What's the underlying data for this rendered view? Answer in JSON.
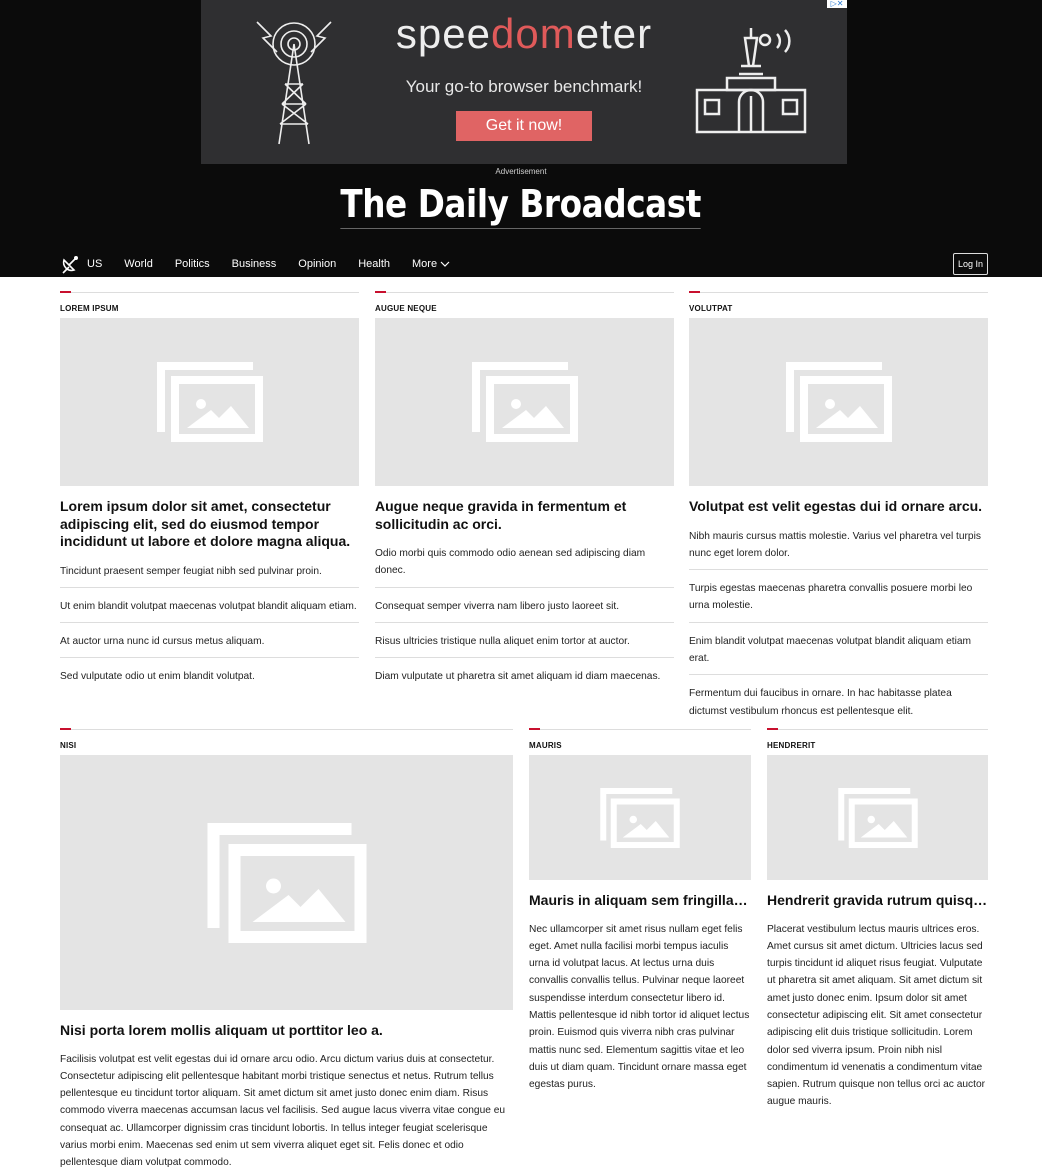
{
  "ad": {
    "brand_part1": "spee",
    "brand_part2": "dom",
    "brand_part3": "eter",
    "tagline": "Your go-to browser benchmark!",
    "cta": "Get it now!",
    "label": "Advertisement",
    "accent": "#e05a5a"
  },
  "masthead": {
    "title": "The Daily Broadcast"
  },
  "nav": {
    "items": [
      "US",
      "World",
      "Politics",
      "Business",
      "Opinion",
      "Health"
    ],
    "more": "More",
    "login": "Log In"
  },
  "top_row": [
    {
      "kicker": "LOREM IPSUM",
      "headline": "Lorem ipsum dolor sit amet, consectetur adipiscing elit, sed do eiusmod tempor incididunt ut labore et dolore magna aliqua.",
      "links": [
        "Tincidunt praesent semper feugiat nibh sed pulvinar proin.",
        "Ut enim blandit volutpat maecenas volutpat blandit aliquam etiam.",
        "At auctor urna nunc id cursus metus aliquam.",
        "Sed vulputate odio ut enim blandit volutpat."
      ]
    },
    {
      "kicker": "AUGUE NEQUE",
      "headline": "Augue neque gravida in fermentum et sollicitudin ac orci.",
      "links": [
        "Odio morbi quis commodo odio aenean sed adipiscing diam donec.",
        "Consequat semper viverra nam libero justo laoreet sit.",
        "Risus ultricies tristique nulla aliquet enim tortor at auctor.",
        "Diam vulputate ut pharetra sit amet aliquam id diam maecenas."
      ]
    },
    {
      "kicker": "VOLUTPAT",
      "headline": "Volutpat est velit egestas dui id ornare arcu.",
      "links": [
        "Nibh mauris cursus mattis molestie. Varius vel pharetra vel turpis nunc eget lorem dolor.",
        "Turpis egestas maecenas pharetra convallis posuere morbi leo urna molestie.",
        "Enim blandit volutpat maecenas volutpat blandit aliquam etiam erat.",
        "Fermentum dui faucibus in ornare. In hac habitasse platea dictumst vestibulum rhoncus est pellentesque elit."
      ]
    }
  ],
  "bottom_row": {
    "main": {
      "kicker": "NISI",
      "headline": "Nisi porta lorem mollis aliquam ut porttitor leo a.",
      "body": "Facilisis volutpat est velit egestas dui id ornare arcu odio. Arcu dictum varius duis at consectetur. Consectetur adipiscing elit pellentesque habitant morbi tristique senectus et netus. Rutrum tellus pellentesque eu tincidunt tortor aliquam. Sit amet dictum sit amet justo donec enim diam. Risus commodo viverra maecenas accumsan lacus vel facilisis. Sed augue lacus viverra vitae congue eu consequat ac. Ullamcorper dignissim cras tincidunt lobortis. In tellus integer feugiat scelerisque varius morbi enim. Maecenas sed enim ut sem viverra aliquet eget sit. Felis donec et odio pellentesque diam volutpat commodo."
    },
    "side1": {
      "kicker": "MAURIS",
      "headline": "Mauris in aliquam sem fringilla ut morbi tincidunt augue interdum.",
      "body": "Nec ullamcorper sit amet risus nullam eget felis eget. Amet nulla facilisi morbi tempus iaculis urna id volutpat lacus. At lectus urna duis convallis convallis tellus. Pulvinar neque laoreet suspendisse interdum consectetur libero id. Mattis pellentesque id nibh tortor id aliquet lectus proin. Euismod quis viverra nibh cras pulvinar mattis nunc sed. Elementum sagittis vitae et leo duis ut diam quam. Tincidunt ornare massa eget egestas purus."
    },
    "side2": {
      "kicker": "HENDRERIT",
      "headline": "Hendrerit gravida rutrum quisque non tellus orci ac auctor.",
      "body": "Placerat vestibulum lectus mauris ultrices eros. Amet cursus sit amet dictum. Ultricies lacus sed turpis tincidunt id aliquet risus feugiat. Vulputate ut pharetra sit amet aliquam. Sit amet dictum sit amet justo donec enim. Ipsum dolor sit amet consectetur adipiscing elit. Sit amet consectetur adipiscing elit duis tristique sollicitudin. Lorem dolor sed viverra ipsum. Proin nibh nisl condimentum id venenatis a condimentum vitae sapien. Rutrum quisque non tellus orci ac auctor augue mauris."
    }
  },
  "colors": {
    "accent_red": "#c8102e",
    "header_bg": "#0b0b0b",
    "placeholder": "#e4e4e4"
  }
}
